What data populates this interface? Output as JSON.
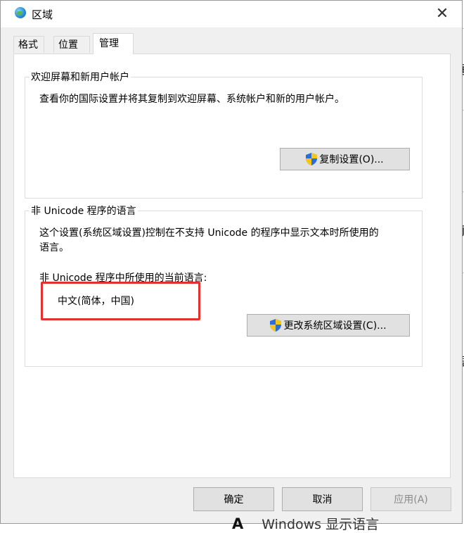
{
  "window": {
    "title": "区域",
    "close_glyph": "✕"
  },
  "tabs": [
    {
      "label": "格式",
      "active": false
    },
    {
      "label": "位置",
      "active": false
    },
    {
      "label": "管理",
      "active": true
    }
  ],
  "welcome_group": {
    "title": "欢迎屏幕和新用户帐户",
    "description": "查看你的国际设置并将其复制到欢迎屏幕、系统帐户和新的用户帐户。",
    "copy_button": "复制设置(O)..."
  },
  "unicode_group": {
    "title": "非 Unicode 程序的语言",
    "description_line1": "这个设置(系统区域设置)控制在不支持 Unicode 的程序中显示文本时所使用的",
    "description_line2": "语言。",
    "current_label": "非 Unicode 程序中所使用的当前语言:",
    "current_value": "中文(简体，中国)",
    "change_button": "更改系统区域设置(C)..."
  },
  "footer": {
    "ok": "确定",
    "cancel": "取消",
    "apply": "应用(A)"
  },
  "background": {
    "bottom_letter": "A",
    "bottom_text": "Windows 显示语言"
  },
  "colors": {
    "highlight_border": "#e53030",
    "dialog_bg": "#f0f0f0"
  }
}
